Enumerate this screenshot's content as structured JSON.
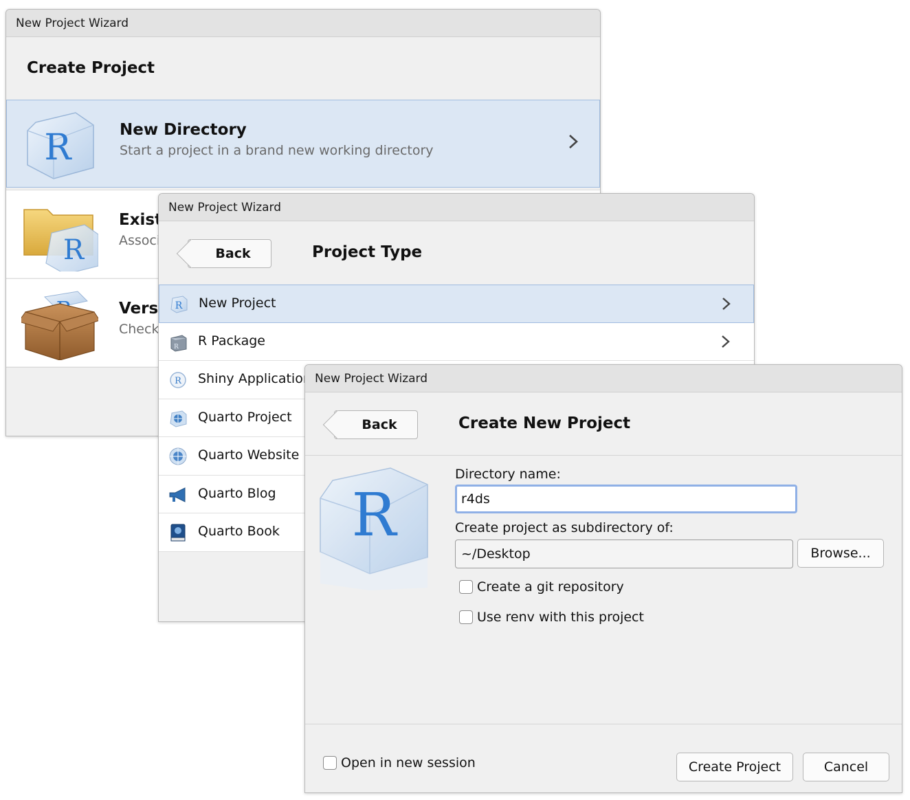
{
  "dialog1": {
    "title": "New Project Wizard",
    "heading": "Create Project",
    "items": [
      {
        "title": "New Directory",
        "subtitle": "Start a project in a brand new working directory",
        "icon": "r-cube-icon"
      },
      {
        "title": "Exist",
        "subtitle": "Associ",
        "icon": "folder-r-icon"
      },
      {
        "title": "Versi",
        "subtitle": "Check",
        "icon": "package-box-icon"
      }
    ]
  },
  "dialog2": {
    "title": "New Project Wizard",
    "back_label": "Back",
    "heading": "Project Type",
    "items": [
      {
        "label": "New Project",
        "icon": "r-project-icon"
      },
      {
        "label": "R Package",
        "icon": "r-package-icon"
      },
      {
        "label": "Shiny Application",
        "icon": "shiny-icon"
      },
      {
        "label": "Quarto Project",
        "icon": "quarto-project-icon"
      },
      {
        "label": "Quarto Website",
        "icon": "quarto-website-icon"
      },
      {
        "label": "Quarto Blog",
        "icon": "quarto-blog-icon"
      },
      {
        "label": "Quarto Book",
        "icon": "quarto-book-icon"
      }
    ]
  },
  "dialog3": {
    "title": "New Project Wizard",
    "back_label": "Back",
    "heading": "Create New Project",
    "dir_name_label": "Directory name:",
    "dir_name_value": "r4ds",
    "subdir_label": "Create project as subdirectory of:",
    "subdir_value": "~/Desktop",
    "browse_label": "Browse...",
    "git_label": "Create a git repository",
    "renv_label": "Use renv with this project",
    "new_session_label": "Open in new session",
    "create_label": "Create Project",
    "cancel_label": "Cancel"
  }
}
